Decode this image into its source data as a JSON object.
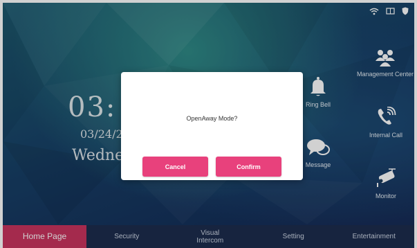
{
  "status_icons": [
    "wifi-icon",
    "screen-icon",
    "shield-icon"
  ],
  "clock": {
    "time": "03:",
    "date": "03/24/2",
    "day": "Wednes"
  },
  "side_menu": {
    "management_center": {
      "label": "Management Center",
      "icon": "management-center-icon"
    },
    "internal_call": {
      "label": "Internal Call",
      "icon": "internal-call-icon"
    },
    "monitor": {
      "label": "Monitor",
      "icon": "monitor-camera-icon"
    },
    "ring_bell": {
      "label": "Ring Bell",
      "icon": "bell-icon"
    },
    "message": {
      "label": "Message",
      "icon": "message-icon"
    }
  },
  "dialog": {
    "message": "OpenAway Mode?",
    "cancel_label": "Cancel",
    "confirm_label": "Confirm",
    "button_color": "#e8417c"
  },
  "tabbar": {
    "active_color": "#c8345f",
    "tabs": [
      {
        "label": "Home Page",
        "active": true
      },
      {
        "label": "Security",
        "active": false
      },
      {
        "label": "Visual Intercom",
        "active": false
      },
      {
        "label": "Setting",
        "active": false
      },
      {
        "label": "Entertainment",
        "active": false
      }
    ]
  }
}
